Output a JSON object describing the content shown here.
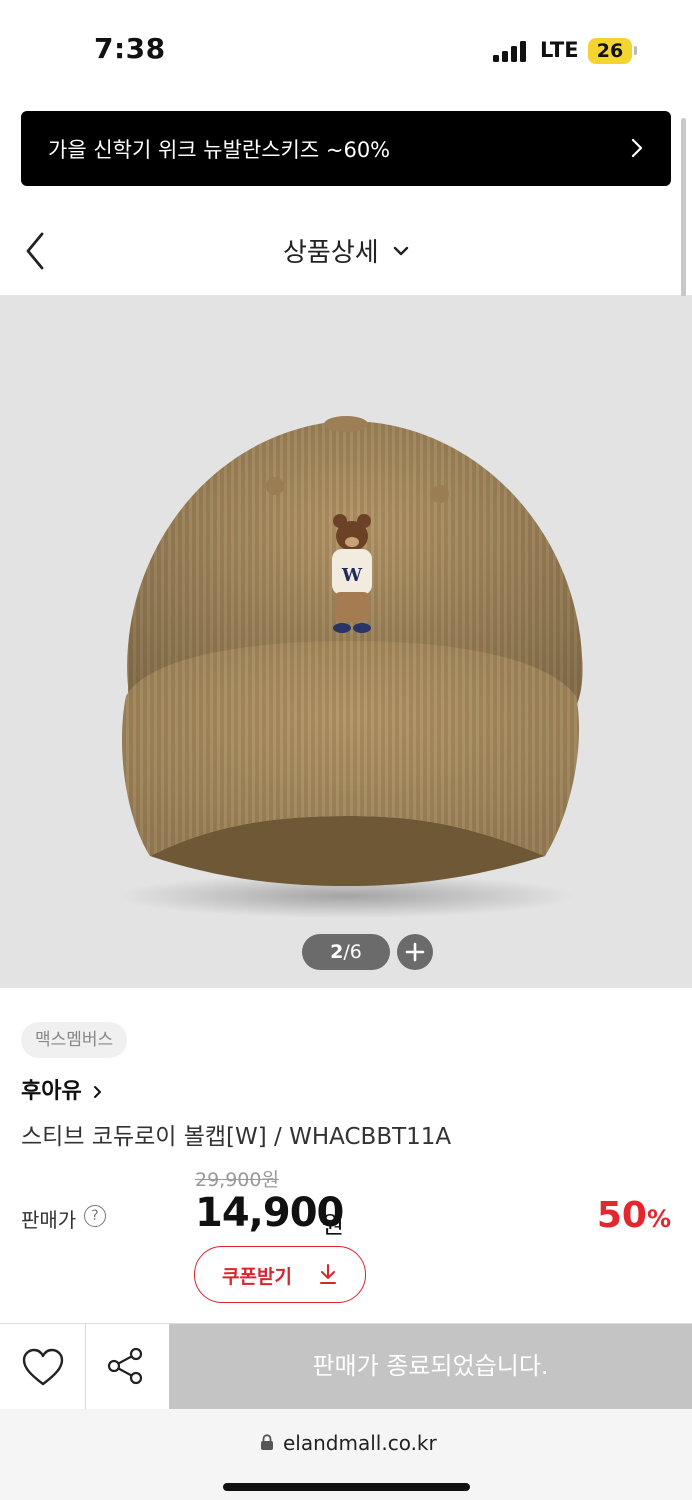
{
  "status_bar": {
    "time": "7:38",
    "network": "LTE",
    "battery": "26"
  },
  "promo_banner": {
    "text": "가을 신학기 위크 뉴발란스키즈 ~60%"
  },
  "header": {
    "title": "상품상세"
  },
  "gallery": {
    "current": "2",
    "total": "/6"
  },
  "product": {
    "badge": "맥스멤버스",
    "brand": "후아유",
    "name": "스티브 코듀로이 볼캡[W] / WHACBBT11A",
    "price_label": "판매가",
    "help": "?",
    "original_price": "29,900원",
    "sale_price": "14,900",
    "sale_unit": "원",
    "discount_rate": "50",
    "discount_unit": "%",
    "coupon_label": "쿠폰받기"
  },
  "bottom_bar": {
    "sold_out_label": "판매가 종료되었습니다."
  },
  "browser": {
    "url": "elandmall.co.kr"
  },
  "colors": {
    "accent_red": "#e5262e",
    "sold_out_gray": "#c4c4c4"
  }
}
